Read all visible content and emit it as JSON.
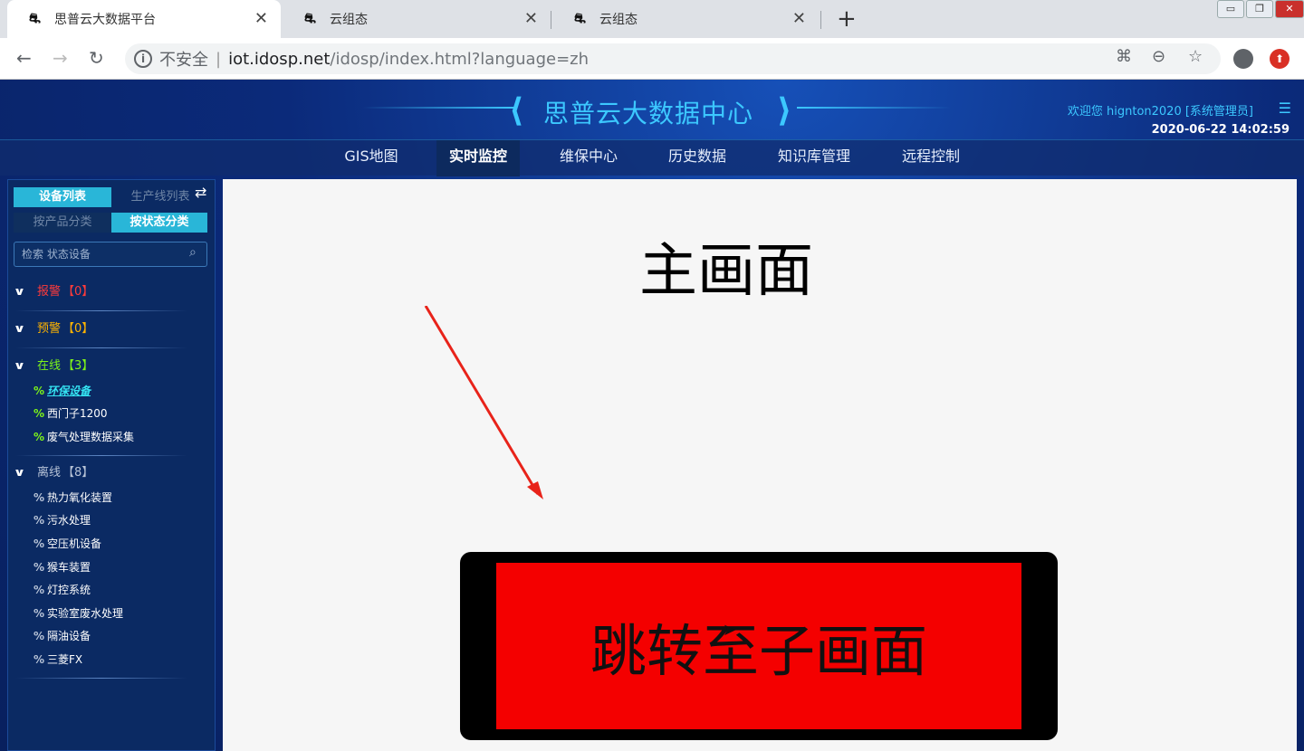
{
  "browser": {
    "tabs": [
      {
        "title": "思普云大数据平台",
        "active": true
      },
      {
        "title": "云组态",
        "active": false
      },
      {
        "title": "云组态",
        "active": false
      }
    ],
    "new_tab": "+",
    "url": {
      "insecure_label": "不安全",
      "host": "iot.idosp.net",
      "path": "/idosp/index.html?language=zh"
    }
  },
  "header": {
    "title": "思普云大数据中心",
    "welcome": "欢迎您  hignton2020 [系统管理员]",
    "datetime": "2020-06-22 14:02:59"
  },
  "nav": [
    {
      "label": "GIS地图",
      "active": false
    },
    {
      "label": "实时监控",
      "active": true
    },
    {
      "label": "维保中心",
      "active": false
    },
    {
      "label": "历史数据",
      "active": false
    },
    {
      "label": "知识库管理",
      "active": false
    },
    {
      "label": "远程控制",
      "active": false
    }
  ],
  "sidebar": {
    "tabs": {
      "device_list": "设备列表",
      "line_list": "生产线列表",
      "by_product": "按产品分类",
      "by_status": "按状态分类"
    },
    "search_placeholder": "检索 状态设备",
    "groups": [
      {
        "name": "报警",
        "count": "【0】",
        "color": "#ff3b3b",
        "devices": []
      },
      {
        "name": "预警",
        "count": "【0】",
        "color": "#ffb400",
        "devices": []
      },
      {
        "name": "在线",
        "count": "【3】",
        "color": "#7cf21a",
        "devices": [
          "环保设备",
          "西门子1200",
          "废气处理数据采集"
        ]
      },
      {
        "name": "离线",
        "count": "【8】",
        "color": "#b6c2d6",
        "devices": [
          "热力氧化装置",
          "污水处理",
          "空压机设备",
          "猴车装置",
          "灯控系统",
          "实验室废水处理",
          "隔油设备",
          "三菱FX"
        ]
      }
    ]
  },
  "content": {
    "title": "主画面",
    "button_label": "跳转至子画面"
  }
}
